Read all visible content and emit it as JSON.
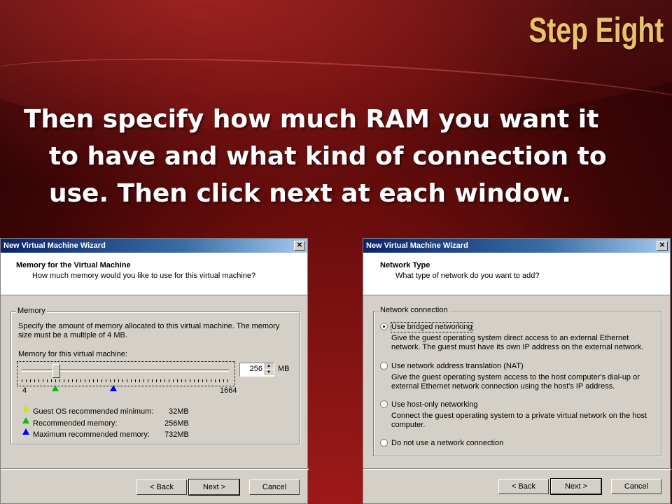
{
  "slide": {
    "title": "Step Eight",
    "line1": "Then specify how much RAM you want it",
    "line2": "to have and what kind of connection to",
    "line3": "use. Then click next at each window."
  },
  "memory_dialog": {
    "window_title": "New Virtual Machine Wizard",
    "close_label": "✕",
    "header_title": "Memory for the Virtual Machine",
    "header_subtitle": "How much memory would you like to use for this virtual machine?",
    "group_label": "Memory",
    "description": "Specify the amount of memory allocated to this virtual machine. The memory size must be a multiple of 4 MB.",
    "field_label": "Memory for this virtual machine:",
    "memory_value": "256",
    "unit": "MB",
    "slider_min_label": "4",
    "slider_max_label": "1664",
    "legend": [
      {
        "label": "Guest OS recommended minimum:",
        "value": "32MB",
        "color": "#ffff00"
      },
      {
        "label": "Recommended memory:",
        "value": "256MB",
        "color": "#00c000"
      },
      {
        "label": "Maximum recommended memory:",
        "value": "732MB",
        "color": "#0000ff"
      }
    ],
    "buttons": {
      "back": "< Back",
      "next": "Next >",
      "cancel": "Cancel"
    }
  },
  "network_dialog": {
    "window_title": "New Virtual Machine Wizard",
    "close_label": "✕",
    "header_title": "Network Type",
    "header_subtitle": "What type of network do you want to add?",
    "group_label": "Network connection",
    "options": [
      {
        "label": "Use bridged networking",
        "selected": true,
        "desc": "Give the guest operating system direct access to an external Ethernet network. The guest must have its own IP address on the external network."
      },
      {
        "label": "Use network address translation (NAT)",
        "selected": false,
        "desc": "Give the guest operating system access to the host computer's dial-up or external Ethernet network connection using the host's IP address."
      },
      {
        "label": "Use host-only networking",
        "selected": false,
        "desc": "Connect the guest operating system to a private virtual network on the host computer."
      },
      {
        "label": "Do not use a network connection",
        "selected": false,
        "desc": ""
      }
    ],
    "buttons": {
      "back": "< Back",
      "next": "Next >",
      "cancel": "Cancel"
    }
  }
}
